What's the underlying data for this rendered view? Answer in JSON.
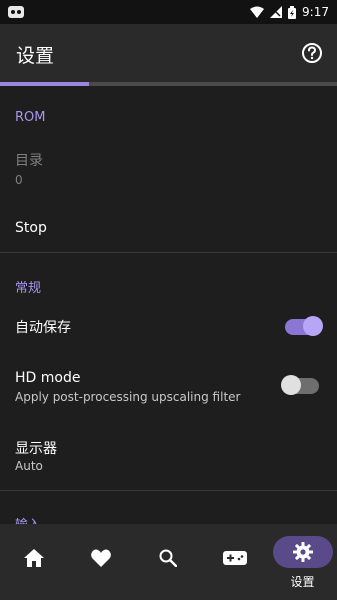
{
  "status_bar": {
    "time": "9:17"
  },
  "header": {
    "title": "设置"
  },
  "progress": {
    "fraction": 0.265
  },
  "sections": {
    "rom": {
      "header": "ROM",
      "directory_label": "目录",
      "directory_value": "0",
      "stop_label": "Stop"
    },
    "general": {
      "header": "常规",
      "autosave_label": "自动保存",
      "autosave_on": true,
      "hd_label": "HD mode",
      "hd_desc": "Apply post-processing upscaling filter",
      "hd_on": false,
      "display_label": "显示器",
      "display_value": "Auto"
    },
    "input": {
      "header": "输入"
    }
  },
  "bottom_nav": {
    "items": [
      {
        "icon": "home-icon"
      },
      {
        "icon": "heart-icon"
      },
      {
        "icon": "search-icon"
      },
      {
        "icon": "gamepad-icon"
      },
      {
        "icon": "gear-icon",
        "label": "设置",
        "active": true
      }
    ]
  },
  "colors": {
    "accent": "#a896ee",
    "toggle_on": "#8b76d4",
    "nav_active_pill": "#5a4a8a"
  }
}
